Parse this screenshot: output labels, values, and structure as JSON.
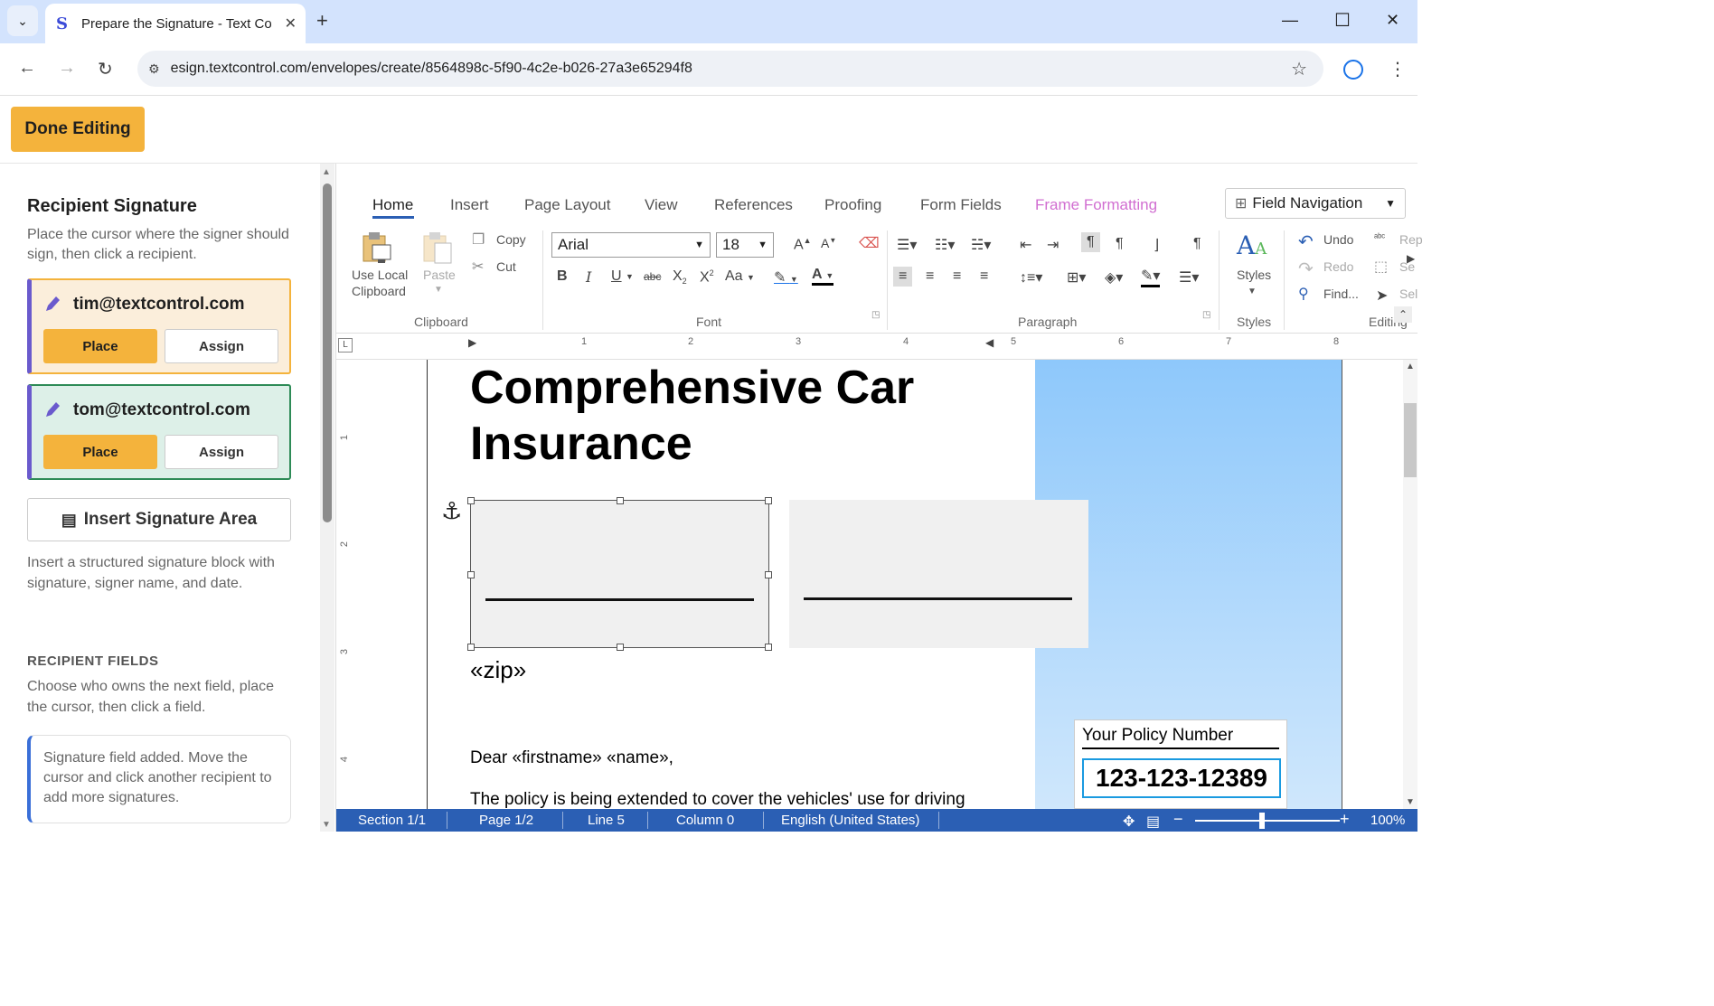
{
  "browser": {
    "tab_title": "Prepare the Signature - Text Control",
    "url": "esign.textcontrol.com/envelopes/create/8564898c-5f90-4c2e-b026-27a3e65294f8"
  },
  "header": {
    "done_label": "Done Editing"
  },
  "sidebar": {
    "title": "Recipient Signature",
    "description": "Place the cursor where the signer should sign, then click a recipient.",
    "recipients": [
      {
        "email": "tim@textcontrol.com",
        "place": "Place",
        "assign": "Assign",
        "color": "#f4b33c"
      },
      {
        "email": "tom@textcontrol.com",
        "place": "Place",
        "assign": "Assign",
        "color": "#2e8b57"
      }
    ],
    "insert_area_label": "Insert Signature Area",
    "insert_area_desc": "Insert a structured signature block with signature, signer name, and date.",
    "fields_title": "RECIPIENT FIELDS",
    "fields_desc": "Choose who owns the next field, place the cursor, then click a field.",
    "notice": "Signature field added. Move the cursor and click another recipient to add more signatures."
  },
  "ribbon": {
    "tabs": [
      "Home",
      "Insert",
      "Page Layout",
      "View",
      "References",
      "Proofing",
      "Form Fields",
      "Frame Formatting"
    ],
    "field_navigation": "Field Navigation",
    "clipboard": {
      "use_local": "Use Local",
      "clipboard": "Clipboard",
      "paste": "Paste",
      "copy": "Copy",
      "cut": "Cut",
      "label": "Clipboard"
    },
    "font": {
      "family": "Arial",
      "size": "18",
      "label": "Font",
      "case": "Aa"
    },
    "paragraph_label": "Paragraph",
    "styles": {
      "button": "Styles",
      "label": "Styles"
    },
    "editing": {
      "undo": "Undo",
      "redo": "Redo",
      "find": "Find...",
      "replace": "Rep",
      "select_all": "Se",
      "select": "Sel",
      "label": "Editing"
    }
  },
  "ruler": {
    "numbers": [
      "1",
      "2",
      "3",
      "4",
      "5",
      "6",
      "7",
      "8"
    ],
    "v_numbers": [
      "1",
      "2",
      "3",
      "4"
    ]
  },
  "document": {
    "title": "Comprehensive Car Insurance",
    "zip": "«zip»",
    "greeting": "Dear «firstname» «name»,",
    "body": "The policy is being extended to cover the vehicles' use for driving",
    "policy_label": "Your Policy Number",
    "policy_number": "123-123-12389"
  },
  "status": {
    "section": "Section 1/1",
    "page": "Page 1/2",
    "line": "Line 5",
    "column": "Column 0",
    "language": "English (United States)",
    "zoom": "100%"
  }
}
